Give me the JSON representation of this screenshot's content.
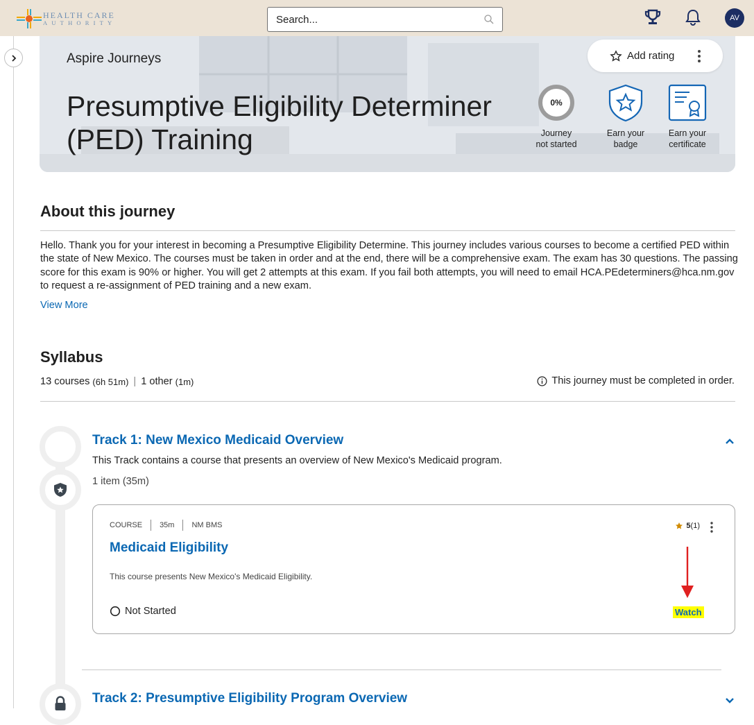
{
  "header": {
    "logo_line1": "HEALTH CARE",
    "logo_line2": "AUTHORITY",
    "search_placeholder": "Search...",
    "avatar_initials": "AV"
  },
  "hero": {
    "breadcrumb": "Aspire Journeys",
    "add_rating_label": "Add rating",
    "title": "Presumptive Eligibility Determiner (PED) Training",
    "progress_percent": "0%",
    "progress_label": "Journey not started",
    "badge_label": "Earn your badge",
    "certificate_label": "Earn your certificate"
  },
  "about": {
    "heading": "About this journey",
    "body": "Hello. Thank you for your interest in becoming a Presumptive Eligibility Determine. This journey includes various courses to become a certified PED within the state of New Mexico. The courses must be taken in order and at the end, there will be a comprehensive exam. The exam has 30 questions. The passing score for this exam is 90% or higher. You will get 2 attempts at this exam. If you fail both attempts, you will need to email HCA.PEdeterminers@hca.nm.gov to request a re-assignment of PED training and a new exam.",
    "view_more": "View More"
  },
  "syllabus": {
    "heading": "Syllabus",
    "courses": "13 courses",
    "courses_duration": "(6h 51m)",
    "other": "1 other",
    "other_duration": "(1m)",
    "order_note": "This journey must be completed in order."
  },
  "tracks": [
    {
      "title": "Track 1: New Mexico Medicaid Overview",
      "description": "This Track contains a course that presents an overview of New Mexico's Medicaid program.",
      "items": "1 item",
      "items_duration": "(35m)",
      "course": {
        "type": "COURSE",
        "duration": "35m",
        "provider": "NM BMS",
        "title": "Medicaid Eligibility",
        "description": "This course presents New Mexico's Medicaid Eligibility.",
        "status": "Not Started",
        "rating": "5",
        "rating_count": "(1)",
        "action": "Watch"
      }
    },
    {
      "title": "Track 2: Presumptive Eligibility Program Overview"
    }
  ],
  "colors": {
    "link": "#0b68b3",
    "highlight": "#ffff00",
    "annotation_arrow": "#e02020",
    "star": "#d08a00",
    "avatar_bg": "#1c2e63",
    "topbar_bg": "#ece3d6"
  }
}
